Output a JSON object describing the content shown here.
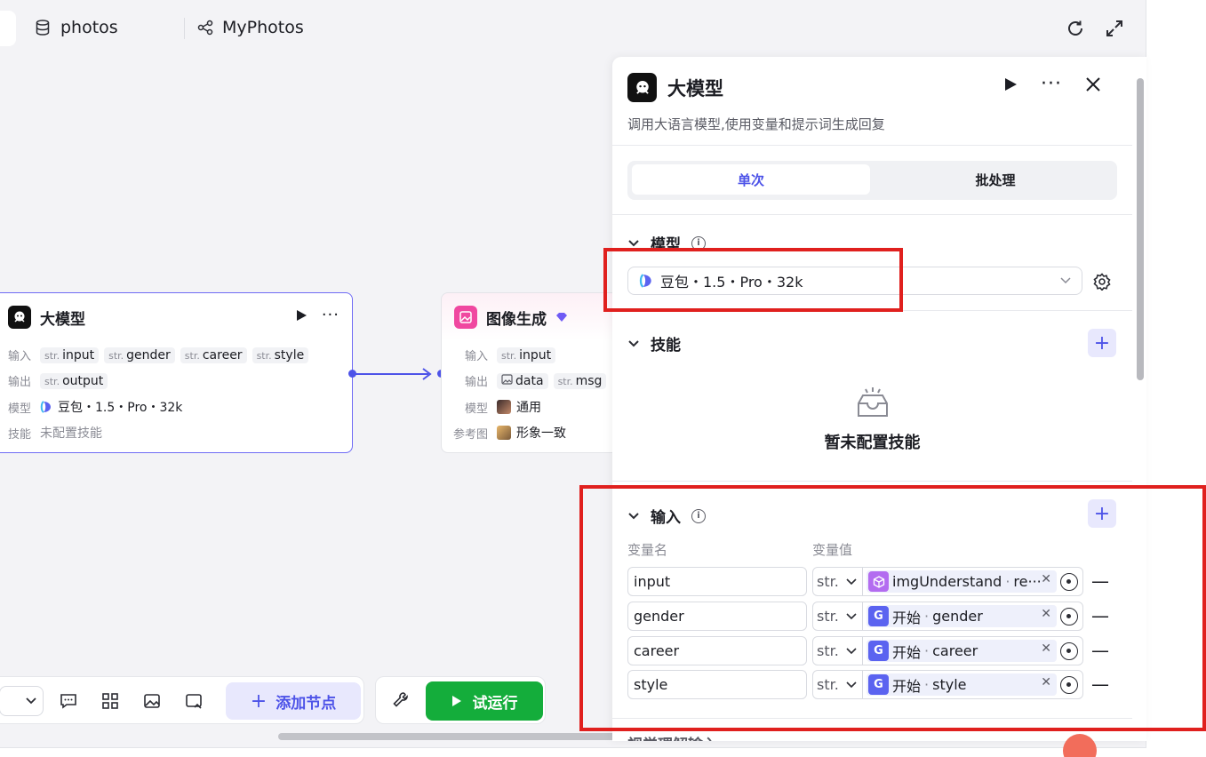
{
  "topbar": {
    "database_label": "photos",
    "workflow_label": "MyPhotos"
  },
  "llm_node": {
    "title": "大模型",
    "input_label": "输入",
    "inputs": [
      {
        "type": "str.",
        "name": "input"
      },
      {
        "type": "str.",
        "name": "gender"
      },
      {
        "type": "str.",
        "name": "career"
      },
      {
        "type": "str.",
        "name": "style"
      }
    ],
    "output_label": "输出",
    "outputs": [
      {
        "type": "str.",
        "name": "output"
      }
    ],
    "model_label": "模型",
    "model_value": "豆包・1.5・Pro・32k",
    "skill_label": "技能",
    "skill_value": "未配置技能"
  },
  "image_node": {
    "title": "图像生成",
    "input_label": "输入",
    "inputs": [
      {
        "type": "str.",
        "name": "input"
      }
    ],
    "output_label": "输出",
    "outputs": [
      {
        "type": "img",
        "name": "data"
      },
      {
        "type": "str.",
        "name": "msg"
      }
    ],
    "model_label": "模型",
    "model_value": "通用",
    "ref_label": "参考图",
    "ref_value": "形象一致"
  },
  "toolbar": {
    "add_node_label": "添加节点",
    "run_label": "试运行"
  },
  "panel": {
    "title": "大模型",
    "description": "调用大语言模型,使用变量和提示词生成回复",
    "tabs": [
      "单次",
      "批处理"
    ],
    "active_tab": "单次",
    "model_section": "模型",
    "model_value": "豆包・1.5・Pro・32k",
    "skill_section": "技能",
    "skill_empty": "暂未配置技能",
    "input_section": "输入",
    "col_name": "变量名",
    "col_value": "变量值",
    "input_rows": [
      {
        "name": "input",
        "type": "str.",
        "source": "imgUnderstand",
        "var": "re···",
        "source_icon": "cube-icon",
        "source_color": "#b36cf0"
      },
      {
        "name": "gender",
        "type": "str.",
        "source": "开始",
        "var": "gender",
        "source_icon": "start-icon",
        "source_color": "#5b63f0"
      },
      {
        "name": "career",
        "type": "str.",
        "source": "开始",
        "var": "career",
        "source_icon": "start-icon",
        "source_color": "#5b63f0"
      },
      {
        "name": "style",
        "type": "str.",
        "source": "开始",
        "var": "style",
        "source_icon": "start-icon",
        "source_color": "#5b63f0"
      }
    ],
    "next_section_peek": "视觉理解输入"
  },
  "colors": {
    "accent": "#4d53e8",
    "run_green": "#14ad3b",
    "highlight_red": "#e0201e"
  }
}
